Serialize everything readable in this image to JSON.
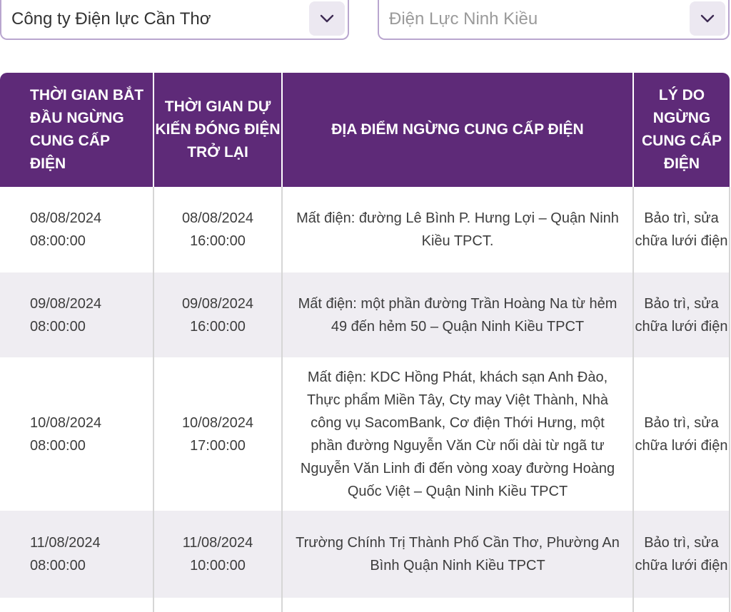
{
  "filters": {
    "company": {
      "value": "Công ty Điện lực Cần Thơ",
      "icon": "chevron-down-icon"
    },
    "branch": {
      "value": "Điện Lực Ninh Kiều",
      "icon": "chevron-down-icon"
    }
  },
  "table": {
    "headers": [
      "THỜI GIAN BẮT ĐẦU NGỪNG CUNG CẤP ĐIỆN",
      "THỜI GIAN DỰ KIẾN ĐÓNG ĐIỆN TRỞ LẠI",
      "ĐỊA ĐIỂM NGỪNG CUNG CẤP ĐIỆN",
      "LÝ DO NGỪNG CUNG CẤP ĐIỆN"
    ],
    "rows": [
      {
        "start_date": "08/08/2024",
        "start_time": "08:00:00",
        "end_date": "08/08/2024",
        "end_time": "16:00:00",
        "location": "Mất điện: đường Lê Bình P. Hưng Lợi – Quận Ninh Kiều TPCT.",
        "reason": "Bảo trì, sửa chữa lưới điện"
      },
      {
        "start_date": "09/08/2024",
        "start_time": "08:00:00",
        "end_date": "09/08/2024",
        "end_time": "16:00:00",
        "location": "Mất điện: một phần đường Trần Hoàng Na từ hẻm 49 đến hẻm 50 – Quận Ninh Kiều TPCT",
        "reason": "Bảo trì, sửa chữa lưới điện"
      },
      {
        "start_date": "10/08/2024",
        "start_time": "08:00:00",
        "end_date": "10/08/2024",
        "end_time": "17:00:00",
        "location": "Mất điện: KDC Hồng Phát, khách sạn Anh Đào, Thực phẩm Miền Tây, Cty may Việt Thành, Nhà công vụ SacomBank, Cơ điện Thới Hưng, một phần đường Nguyễn Văn Cừ nối dài từ ngã tư Nguyễn Văn Linh đi đến vòng xoay đường Hoàng Quốc Việt – Quận Ninh Kiều TPCT",
        "reason": "Bảo trì, sửa chữa lưới điện"
      },
      {
        "start_date": "11/08/2024",
        "start_time": "08:00:00",
        "end_date": "11/08/2024",
        "end_time": "10:00:00",
        "location": "Trường Chính Trị Thành Phố Cần Thơ, Phường An Bình Quận Ninh Kiều TPCT",
        "reason": "Bảo trì, sửa chữa lưới điện"
      }
    ]
  },
  "colors": {
    "header_bg": "#5e2a78",
    "stripe_bg": "#efedf2",
    "select_border": "#b9a6cf"
  }
}
